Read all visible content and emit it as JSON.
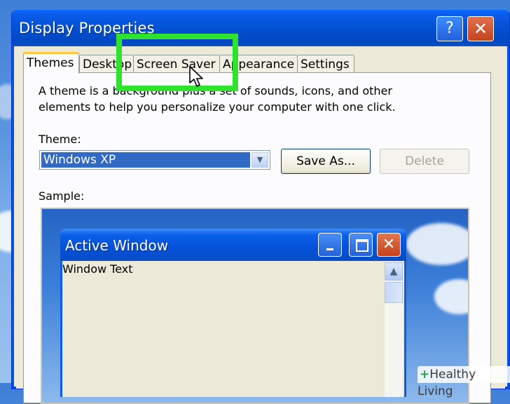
{
  "window": {
    "title": "Display Properties",
    "help_label": "?",
    "close_label": "✕"
  },
  "tabs": [
    {
      "label": "Themes",
      "active": true
    },
    {
      "label": "Desktop",
      "active": false
    },
    {
      "label": "Screen Saver",
      "active": false
    },
    {
      "label": "Appearance",
      "active": false
    },
    {
      "label": "Settings",
      "active": false
    }
  ],
  "themes_panel": {
    "description": "A theme is a background plus a set of sounds, icons, and other elements to help you personalize your computer with one click.",
    "theme_label": "Theme:",
    "theme_value": "Windows XP",
    "save_as_label": "Save As...",
    "delete_label": "Delete",
    "sample_label": "Sample:"
  },
  "sample_window": {
    "title": "Active Window",
    "body_text": "Window Text"
  },
  "watermark": {
    "plus": "+",
    "text": "Healthy Living"
  },
  "colors": {
    "titlebar_blue": "#0552d5",
    "highlight_green": "#2ee22e",
    "close_red": "#c4451e",
    "selection_blue": "#316ac5"
  },
  "icons": [
    "help-icon",
    "close-icon",
    "dropdown-arrow-icon",
    "minimize-icon",
    "maximize-icon",
    "scroll-up-icon",
    "mouse-cursor-icon"
  ]
}
